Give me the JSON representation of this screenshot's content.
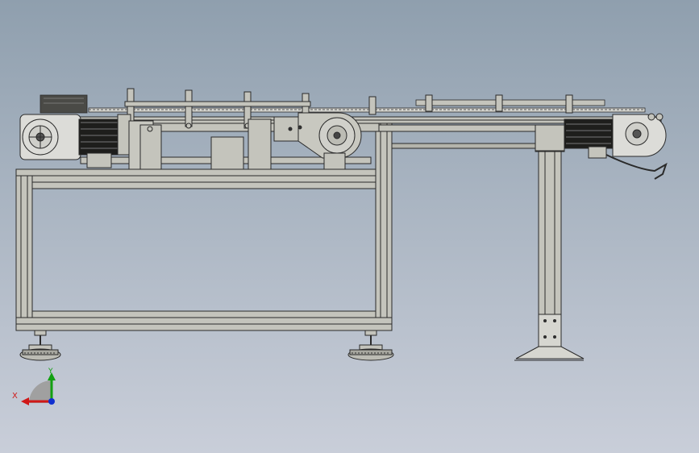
{
  "view": {
    "background_top": "#8f9fae",
    "background_bottom": "#c9ced9",
    "part_fill": "#c4c4bc",
    "part_stroke": "#2a2a2a",
    "motor_fill": "#dcdcd8"
  },
  "triad": {
    "x_label": "X",
    "y_label": "Y",
    "x_color": "#d01818",
    "y_color": "#12a012",
    "z_color": "#1030d0"
  }
}
